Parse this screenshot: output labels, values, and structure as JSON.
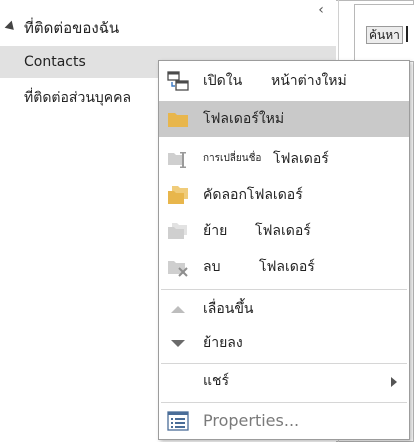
{
  "nav": {
    "group_title": "ที่ติดต่อของฉัน",
    "items": [
      {
        "label": "Contacts"
      },
      {
        "label": "ที่ติดต่อส่วนบุคคล"
      }
    ]
  },
  "search": {
    "label": "ค้นหา"
  },
  "menu": {
    "open_in": "เปิดใน",
    "open_in_target": "หน้าต่างใหม่",
    "new_folder": "โฟลเดอร์ใหม่",
    "rename_a": "การเปลี่ยนชื่อ",
    "rename_b": "โฟลเดอร์",
    "copy_folder": "คัดลอกโฟลเดอร์",
    "move_a": "ย้าย",
    "move_b": "โฟลเดอร์",
    "delete_a": "ลบ",
    "delete_b": "โฟลเดอร์",
    "move_up": "เลื่อนขึ้น",
    "move_down": "ย้ายลง",
    "share": "แชร์",
    "properties": "Properties..."
  },
  "colors": {
    "folder": "#e8b64c",
    "highlight": "#c9c9c9",
    "disabled": "#bdbdbd"
  }
}
